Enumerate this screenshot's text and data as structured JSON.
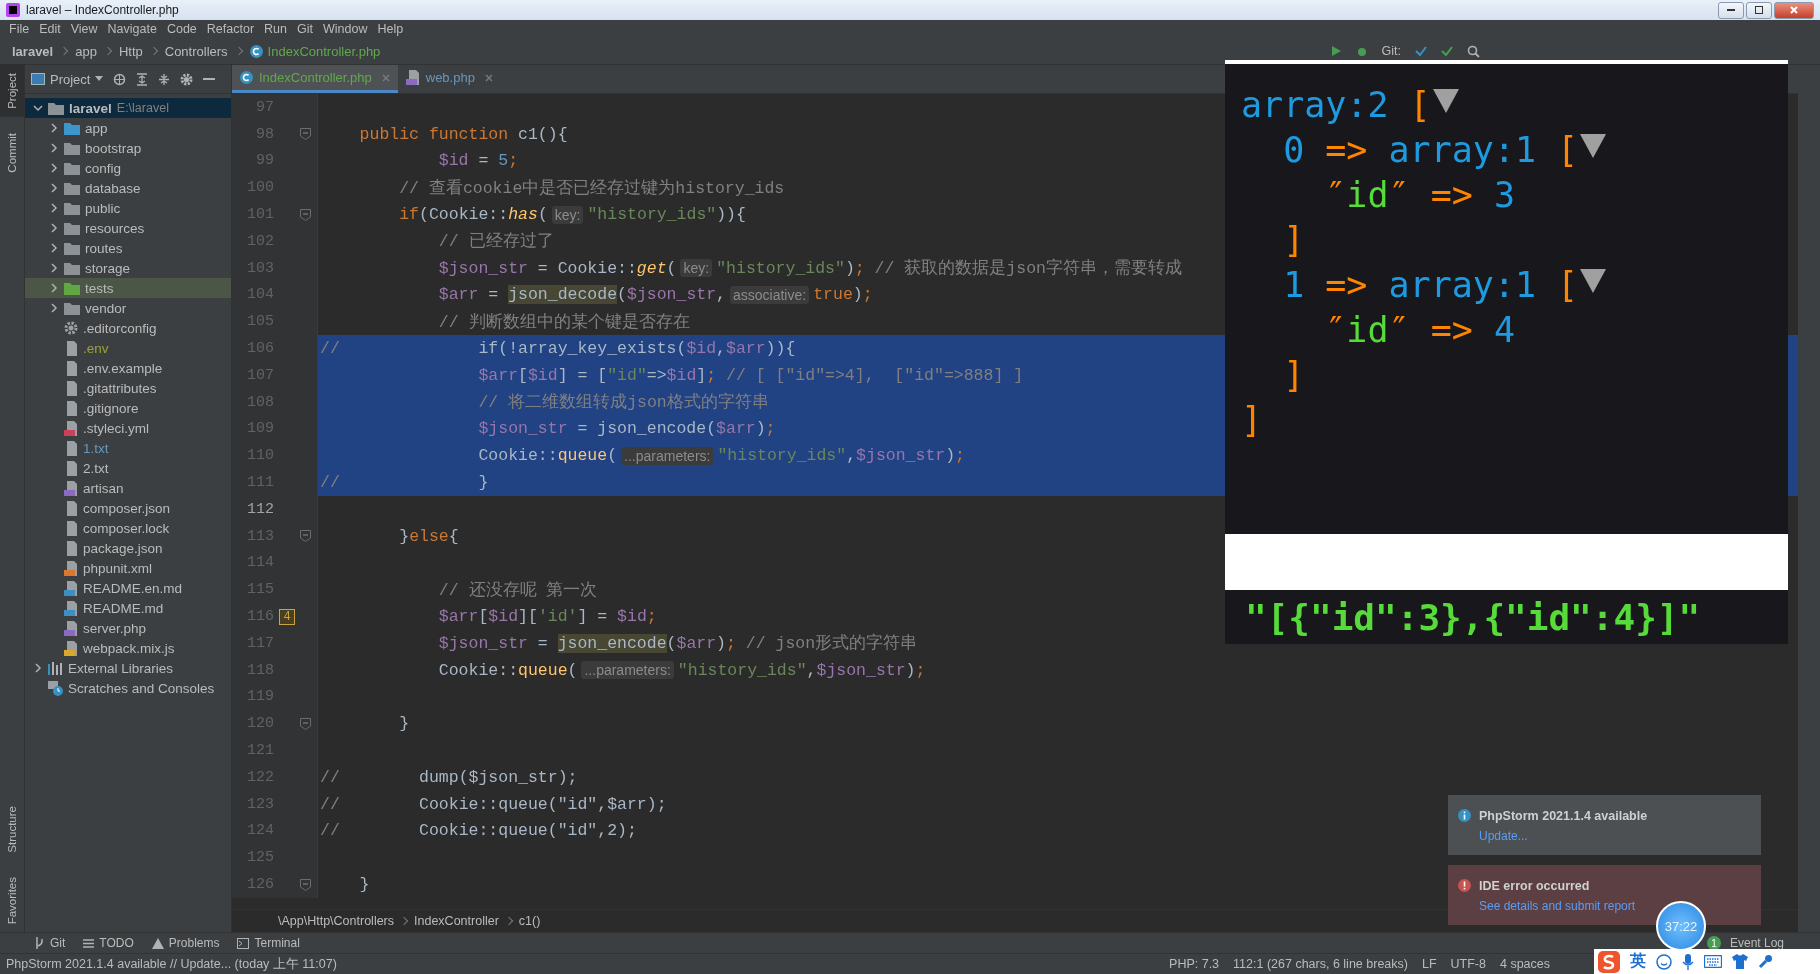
{
  "window": {
    "title": "laravel – IndexController.php"
  },
  "menu": [
    "File",
    "Edit",
    "View",
    "Navigate",
    "Code",
    "Refactor",
    "Run",
    "Git",
    "Window",
    "Help"
  ],
  "nav_breadcrumb": [
    "laravel",
    "app",
    "Http",
    "Controllers",
    "IndexController.php"
  ],
  "toolbar": {
    "git_label": "Git:"
  },
  "left_strip": {
    "top": [
      {
        "label": "Project",
        "selected": true
      },
      {
        "label": "Commit",
        "selected": false
      }
    ],
    "bottom": [
      "Structure",
      "Favorites"
    ]
  },
  "project": {
    "title": "Project",
    "root": {
      "name": "laravel",
      "path": "E:\\laravel",
      "expanded": true,
      "selected": true
    },
    "items": [
      {
        "name": "app",
        "kind": "source-folder",
        "expanded": false,
        "color": "#bbbbbb",
        "highlighted": false
      },
      {
        "name": "bootstrap",
        "kind": "folder",
        "expanded": false,
        "color": "#bbbbbb",
        "highlighted": false
      },
      {
        "name": "config",
        "kind": "folder",
        "expanded": false,
        "color": "#bbbbbb",
        "highlighted": false
      },
      {
        "name": "database",
        "kind": "folder",
        "expanded": false,
        "color": "#bbbbbb",
        "highlighted": false
      },
      {
        "name": "public",
        "kind": "folder",
        "expanded": false,
        "color": "#bbbbbb",
        "highlighted": false
      },
      {
        "name": "resources",
        "kind": "folder",
        "expanded": false,
        "color": "#bbbbbb",
        "highlighted": false
      },
      {
        "name": "routes",
        "kind": "folder",
        "expanded": false,
        "color": "#bbbbbb",
        "highlighted": false
      },
      {
        "name": "storage",
        "kind": "folder",
        "expanded": false,
        "color": "#bbbbbb",
        "highlighted": false
      },
      {
        "name": "tests",
        "kind": "test-folder",
        "expanded": false,
        "color": "#bbbbbb",
        "highlighted": true
      },
      {
        "name": "vendor",
        "kind": "folder",
        "expanded": false,
        "color": "#bbbbbb",
        "highlighted": false
      },
      {
        "name": ".editorconfig",
        "kind": "config",
        "color": "#bbbbbb",
        "highlighted": false
      },
      {
        "name": ".env",
        "kind": "text",
        "color": "#a0a034",
        "highlighted": false
      },
      {
        "name": ".env.example",
        "kind": "text",
        "color": "#bbbbbb",
        "highlighted": false
      },
      {
        "name": ".gitattributes",
        "kind": "text",
        "color": "#bbbbbb",
        "highlighted": false
      },
      {
        "name": ".gitignore",
        "kind": "text",
        "color": "#bbbbbb",
        "highlighted": false
      },
      {
        "name": ".styleci.yml",
        "kind": "yml",
        "color": "#bbbbbb",
        "highlighted": false
      },
      {
        "name": "1.txt",
        "kind": "text",
        "color": "#6897bb",
        "highlighted": false
      },
      {
        "name": "2.txt",
        "kind": "text",
        "color": "#bbbbbb",
        "highlighted": false
      },
      {
        "name": "artisan",
        "kind": "php",
        "color": "#bbbbbb",
        "highlighted": false
      },
      {
        "name": "composer.json",
        "kind": "json",
        "color": "#bbbbbb",
        "highlighted": false
      },
      {
        "name": "composer.lock",
        "kind": "json",
        "color": "#bbbbbb",
        "highlighted": false
      },
      {
        "name": "package.json",
        "kind": "json",
        "color": "#bbbbbb",
        "highlighted": false
      },
      {
        "name": "phpunit.xml",
        "kind": "xml",
        "color": "#bbbbbb",
        "highlighted": false
      },
      {
        "name": "README.en.md",
        "kind": "md",
        "color": "#bbbbbb",
        "highlighted": false
      },
      {
        "name": "README.md",
        "kind": "md",
        "color": "#bbbbbb",
        "highlighted": false
      },
      {
        "name": "server.php",
        "kind": "php",
        "color": "#bbbbbb",
        "highlighted": false
      },
      {
        "name": "webpack.mix.js",
        "kind": "js",
        "color": "#bbbbbb",
        "highlighted": false
      }
    ],
    "extras": [
      {
        "name": "External Libraries",
        "kind": "libraries",
        "expanded": false
      },
      {
        "name": "Scratches and Consoles",
        "kind": "scratches"
      }
    ]
  },
  "tabs": [
    {
      "label": "IndexController.php",
      "kind": "php-class",
      "selected": true,
      "color": "#62a84b"
    },
    {
      "label": "web.php",
      "kind": "php",
      "selected": false,
      "color": "#6897bb"
    }
  ],
  "code": {
    "lines": [
      {
        "num": "97",
        "selected": false,
        "fold": false
      },
      {
        "num": "98",
        "selected": false,
        "fold": true,
        "tokens": [
          {
            "kind": "kw",
            "text": "    public function "
          },
          {
            "kind": "plain",
            "text": "c1(){"
          }
        ]
      },
      {
        "num": "99",
        "selected": false,
        "fold": false,
        "tokens": [
          {
            "kind": "var",
            "text": "            $id"
          },
          {
            "kind": "plain",
            "text": " = "
          },
          {
            "kind": "num",
            "text": "5"
          },
          {
            "kind": "kw",
            "text": ";"
          }
        ]
      },
      {
        "num": "100",
        "selected": false,
        "fold": false,
        "tokens": [
          {
            "kind": "cmt",
            "text": "        // 查看cookie中是否已经存过键为history_ids"
          }
        ]
      },
      {
        "num": "101",
        "selected": false,
        "fold": true,
        "tokens": [
          {
            "kind": "kw",
            "text": "        if"
          },
          {
            "kind": "plain",
            "text": "(Cookie::"
          },
          {
            "kind": "fn-static",
            "text": "has"
          },
          {
            "kind": "plain",
            "text": "("
          },
          {
            "kind": "hint",
            "text": "key:"
          },
          {
            "kind": "str",
            "text": "\"history_ids\""
          },
          {
            "kind": "plain",
            "text": ")){"
          }
        ]
      },
      {
        "num": "102",
        "selected": false,
        "fold": false,
        "tokens": [
          {
            "kind": "cmt",
            "text": "            // 已经存过了"
          }
        ]
      },
      {
        "num": "103",
        "selected": false,
        "fold": false,
        "tokens": [
          {
            "kind": "var",
            "text": "            $json_str"
          },
          {
            "kind": "plain",
            "text": " = Cookie::"
          },
          {
            "kind": "fn-static",
            "text": "get"
          },
          {
            "kind": "plain",
            "text": "("
          },
          {
            "kind": "hint",
            "text": "key:"
          },
          {
            "kind": "str",
            "text": "\"history_ids\""
          },
          {
            "kind": "plain",
            "text": ")"
          },
          {
            "kind": "kw",
            "text": ";"
          },
          {
            "kind": "cmt",
            "text": " // 获取的数据是json字符串，需要转成"
          }
        ]
      },
      {
        "num": "104",
        "selected": false,
        "fold": false,
        "tokens": [
          {
            "kind": "var",
            "text": "            $arr"
          },
          {
            "kind": "plain",
            "text": " = "
          },
          {
            "kind": "hl",
            "text": "json_decode"
          },
          {
            "kind": "plain",
            "text": "("
          },
          {
            "kind": "var",
            "text": "$json_str"
          },
          {
            "kind": "plain",
            "text": ","
          },
          {
            "kind": "hint",
            "text": "associative:"
          },
          {
            "kind": "kw",
            "text": "true"
          },
          {
            "kind": "plain",
            "text": ")"
          },
          {
            "kind": "kw",
            "text": ";"
          }
        ]
      },
      {
        "num": "105",
        "selected": false,
        "fold": false,
        "tokens": [
          {
            "kind": "cmt",
            "text": "            // 判断数组中的某个键是否存在"
          }
        ]
      },
      {
        "num": "106",
        "selected": true,
        "fold": false,
        "tokens": [
          {
            "kind": "cmt",
            "text": "//"
          },
          {
            "kind": "plain",
            "text": "              if(!array_key_exists("
          },
          {
            "kind": "var",
            "text": "$id"
          },
          {
            "kind": "plain",
            "text": ","
          },
          {
            "kind": "var",
            "text": "$arr"
          },
          {
            "kind": "plain",
            "text": ")){"
          }
        ]
      },
      {
        "num": "107",
        "selected": true,
        "fold": false,
        "tokens": [
          {
            "kind": "var",
            "text": "                $arr"
          },
          {
            "kind": "plain",
            "text": "["
          },
          {
            "kind": "var",
            "text": "$id"
          },
          {
            "kind": "plain",
            "text": "] = ["
          },
          {
            "kind": "str",
            "text": "\"id\""
          },
          {
            "kind": "plain",
            "text": "=>"
          },
          {
            "kind": "var",
            "text": "$id"
          },
          {
            "kind": "plain",
            "text": "]"
          },
          {
            "kind": "kw",
            "text": ";"
          },
          {
            "kind": "cmt",
            "text": " // [ [\"id\"=>4],  [\"id\"=>888] ]"
          }
        ]
      },
      {
        "num": "108",
        "selected": true,
        "fold": false,
        "tokens": [
          {
            "kind": "cmt",
            "text": "                // 将二维数组转成json格式的字符串"
          }
        ]
      },
      {
        "num": "109",
        "selected": true,
        "fold": false,
        "tokens": [
          {
            "kind": "var",
            "text": "                $json_str"
          },
          {
            "kind": "plain",
            "text": " = json_encode("
          },
          {
            "kind": "var",
            "text": "$arr"
          },
          {
            "kind": "plain",
            "text": ")"
          },
          {
            "kind": "kw",
            "text": ";"
          }
        ]
      },
      {
        "num": "110",
        "selected": true,
        "fold": false,
        "tokens": [
          {
            "kind": "plain",
            "text": "                Cookie::"
          },
          {
            "kind": "fn",
            "text": "queue"
          },
          {
            "kind": "plain",
            "text": "("
          },
          {
            "kind": "hint",
            "text": "...parameters:"
          },
          {
            "kind": "str",
            "text": "\"history_ids\""
          },
          {
            "kind": "plain",
            "text": ","
          },
          {
            "kind": "var",
            "text": "$json_str"
          },
          {
            "kind": "plain",
            "text": ")"
          },
          {
            "kind": "kw",
            "text": ";"
          }
        ]
      },
      {
        "num": "111",
        "selected": true,
        "fold": false,
        "tokens": [
          {
            "kind": "cmt",
            "text": "//"
          },
          {
            "kind": "plain",
            "text": "              }"
          }
        ]
      },
      {
        "num": "112",
        "selected": false,
        "fold": false
      },
      {
        "num": "113",
        "selected": false,
        "fold": true,
        "tokens": [
          {
            "kind": "plain",
            "text": "        }"
          },
          {
            "kind": "kw",
            "text": "else"
          },
          {
            "kind": "plain",
            "text": "{"
          }
        ]
      },
      {
        "num": "114",
        "selected": false,
        "fold": false
      },
      {
        "num": "115",
        "selected": false,
        "fold": false,
        "tokens": [
          {
            "kind": "cmt",
            "text": "            // 还没存呢 第一次"
          }
        ]
      },
      {
        "num": "116",
        "selected": false,
        "fold": false,
        "badge": "4",
        "tokens": [
          {
            "kind": "var",
            "text": "            $arr"
          },
          {
            "kind": "plain",
            "text": "["
          },
          {
            "kind": "var",
            "text": "$id"
          },
          {
            "kind": "plain",
            "text": "]["
          },
          {
            "kind": "str",
            "text": "'id'"
          },
          {
            "kind": "plain",
            "text": "] = "
          },
          {
            "kind": "var",
            "text": "$id"
          },
          {
            "kind": "kw",
            "text": ";"
          }
        ]
      },
      {
        "num": "117",
        "selected": false,
        "fold": false,
        "tokens": [
          {
            "kind": "var",
            "text": "            $json_str"
          },
          {
            "kind": "plain",
            "text": " = "
          },
          {
            "kind": "hl",
            "text": "json_encode"
          },
          {
            "kind": "plain",
            "text": "("
          },
          {
            "kind": "var",
            "text": "$arr"
          },
          {
            "kind": "plain",
            "text": ")"
          },
          {
            "kind": "kw",
            "text": ";"
          },
          {
            "kind": "cmt",
            "text": " // json形式的字符串"
          }
        ]
      },
      {
        "num": "118",
        "selected": false,
        "fold": false,
        "tokens": [
          {
            "kind": "plain",
            "text": "            Cookie::"
          },
          {
            "kind": "fn",
            "text": "queue"
          },
          {
            "kind": "plain",
            "text": "("
          },
          {
            "kind": "hint",
            "text": "...parameters:"
          },
          {
            "kind": "str",
            "text": "\"history_ids\""
          },
          {
            "kind": "plain",
            "text": ","
          },
          {
            "kind": "var",
            "text": "$json_str"
          },
          {
            "kind": "plain",
            "text": ")"
          },
          {
            "kind": "kw",
            "text": ";"
          }
        ]
      },
      {
        "num": "119",
        "selected": false,
        "fold": false
      },
      {
        "num": "120",
        "selected": false,
        "fold": true,
        "tokens": [
          {
            "kind": "plain",
            "text": "        }"
          }
        ]
      },
      {
        "num": "121",
        "selected": false,
        "fold": false
      },
      {
        "num": "122",
        "selected": false,
        "fold": false,
        "tokens": [
          {
            "kind": "cmt",
            "text": "//"
          },
          {
            "kind": "plain",
            "text": "        dump($json_str);"
          }
        ]
      },
      {
        "num": "123",
        "selected": false,
        "fold": false,
        "tokens": [
          {
            "kind": "cmt",
            "text": "//"
          },
          {
            "kind": "plain",
            "text": "        Cookie::queue(\"id\",$arr);"
          }
        ]
      },
      {
        "num": "124",
        "selected": false,
        "fold": false,
        "tokens": [
          {
            "kind": "cmt",
            "text": "//"
          },
          {
            "kind": "plain",
            "text": "        Cookie::queue(\"id\",2);"
          }
        ]
      },
      {
        "num": "125",
        "selected": false,
        "fold": false
      },
      {
        "num": "126",
        "selected": false,
        "fold": true,
        "tokens": [
          {
            "kind": "plain",
            "text": "    }"
          }
        ]
      }
    ]
  },
  "editor_breadcrumb": [
    "\\App\\Http\\Controllers",
    "IndexController",
    "c1()"
  ],
  "dump": {
    "lines": [
      {
        "toggle": true,
        "tokens": [
          {
            "kind": "type",
            "text": "array:2 "
          },
          {
            "kind": "bracket",
            "text": "["
          }
        ]
      },
      {
        "toggle": true,
        "tokens": [
          {
            "kind": "type",
            "text": "  0 "
          },
          {
            "kind": "bracket",
            "text": "=> "
          },
          {
            "kind": "type",
            "text": "array:1 "
          },
          {
            "kind": "bracket",
            "text": "["
          }
        ]
      },
      {
        "toggle": false,
        "tokens": [
          {
            "kind": "bracket",
            "text": "    ″"
          },
          {
            "kind": "key",
            "text": "id"
          },
          {
            "kind": "bracket",
            "text": "″ => "
          },
          {
            "kind": "type",
            "text": "3"
          }
        ]
      },
      {
        "toggle": false,
        "tokens": [
          {
            "kind": "bracket",
            "text": "  ]"
          }
        ]
      },
      {
        "toggle": true,
        "tokens": [
          {
            "kind": "type",
            "text": "  1 "
          },
          {
            "kind": "bracket",
            "text": "=> "
          },
          {
            "kind": "type",
            "text": "array:1 "
          },
          {
            "kind": "bracket",
            "text": "["
          }
        ]
      },
      {
        "toggle": false,
        "tokens": [
          {
            "kind": "bracket",
            "text": "    ″"
          },
          {
            "kind": "key",
            "text": "id"
          },
          {
            "kind": "bracket",
            "text": "″ => "
          },
          {
            "kind": "type",
            "text": "4"
          }
        ]
      },
      {
        "toggle": false,
        "tokens": [
          {
            "kind": "bracket",
            "text": "  ]"
          }
        ]
      },
      {
        "toggle": false,
        "tokens": [
          {
            "kind": "bracket",
            "text": "]"
          }
        ]
      }
    ],
    "json_output": "\"[{\"id\":3},{\"id\":4}]\""
  },
  "notifications": [
    {
      "kind": "info",
      "title": "PhpStorm 2021.1.4 available",
      "link": "Update..."
    },
    {
      "kind": "error",
      "title": "IDE error occurred",
      "link": "See details and submit report"
    }
  ],
  "timer": "37:22",
  "tool_windows": [
    {
      "label": "Git",
      "kind": "git"
    },
    {
      "label": "TODO",
      "kind": "todo"
    },
    {
      "label": "Problems",
      "kind": "problems"
    },
    {
      "label": "Terminal",
      "kind": "terminal"
    }
  ],
  "event_log": {
    "label": "Event Log",
    "count": "1"
  },
  "status_bar": {
    "message": "PhpStorm 2021.1.4 available // Update... (today 上午 11:07)",
    "items": [
      "PHP: 7.3",
      "112:1 (267 chars, 6 line breaks)",
      "LF",
      "UTF-8",
      "4 spaces"
    ]
  },
  "ime": {
    "mode": "英"
  }
}
